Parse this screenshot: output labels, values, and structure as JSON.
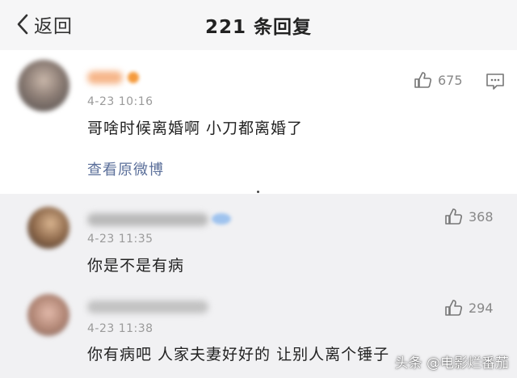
{
  "header": {
    "back_label": "返回",
    "title": "221 条回复"
  },
  "comments": [
    {
      "time": "4-23 10:16",
      "content": "哥啥时候离婚啊 小刀都离婚了",
      "likes": "675",
      "view_original": "查看原微博"
    },
    {
      "time": "4-23 11:35",
      "content": "你是不是有病",
      "likes": "368"
    },
    {
      "time": "4-23 11:38",
      "content": "你有病吧  人家夫妻好好的  让别人离个锤子",
      "likes": "294"
    }
  ],
  "watermark": "头条 @电影烂番茄",
  "colors": {
    "link": "#5b6f9a",
    "time": "#9a9a9a",
    "background": "#f1f1f3"
  }
}
